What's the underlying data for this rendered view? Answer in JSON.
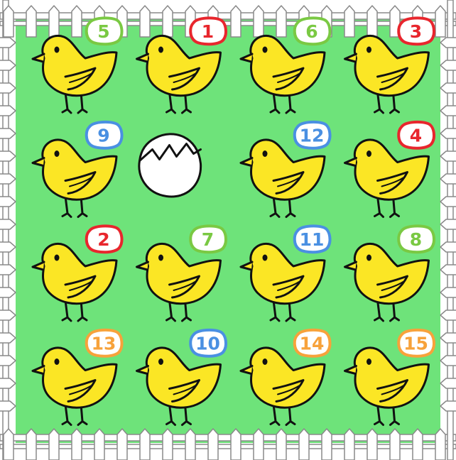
{
  "colors": {
    "field": "#6ee37a",
    "fence_fill": "#ffffff",
    "fence_stroke": "#8a8a8a",
    "chick_body": "#fbe625",
    "outline": "#111111",
    "egg": "#ffffff"
  },
  "badge_colors": {
    "green": "#7ac943",
    "red": "#e8262d",
    "blue": "#4a90e2",
    "orange": "#f7a23b"
  },
  "board": {
    "rows": 4,
    "cols": 4,
    "tiles": [
      {
        "type": "chick",
        "number": "5",
        "color": "green"
      },
      {
        "type": "chick",
        "number": "1",
        "color": "red"
      },
      {
        "type": "chick",
        "number": "6",
        "color": "green"
      },
      {
        "type": "chick",
        "number": "3",
        "color": "red"
      },
      {
        "type": "chick",
        "number": "9",
        "color": "blue"
      },
      {
        "type": "egg"
      },
      {
        "type": "chick",
        "number": "12",
        "color": "blue"
      },
      {
        "type": "chick",
        "number": "4",
        "color": "red"
      },
      {
        "type": "chick",
        "number": "2",
        "color": "red"
      },
      {
        "type": "chick",
        "number": "7",
        "color": "green"
      },
      {
        "type": "chick",
        "number": "11",
        "color": "blue"
      },
      {
        "type": "chick",
        "number": "8",
        "color": "green"
      },
      {
        "type": "chick",
        "number": "13",
        "color": "orange"
      },
      {
        "type": "chick",
        "number": "10",
        "color": "blue"
      },
      {
        "type": "chick",
        "number": "14",
        "color": "orange"
      },
      {
        "type": "chick",
        "number": "15",
        "color": "orange"
      }
    ]
  }
}
